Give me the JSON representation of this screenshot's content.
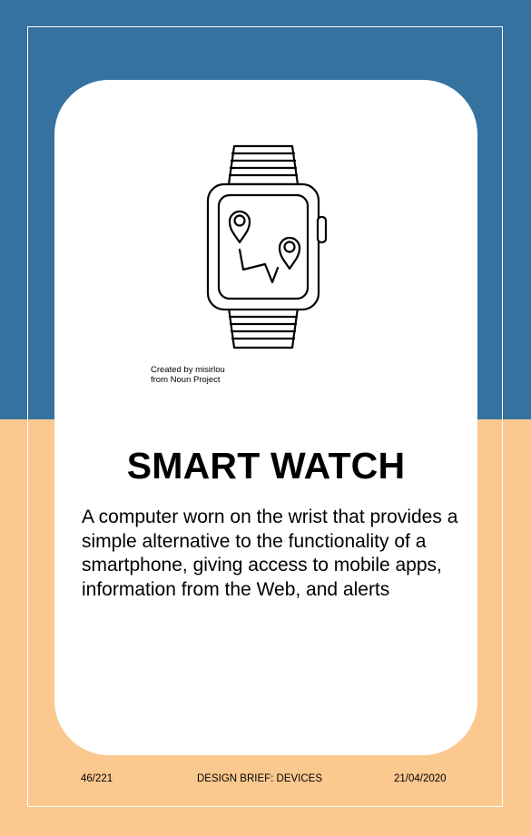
{
  "card": {
    "title": "SMART WATCH",
    "description": "A computer worn on the wrist that provides a simple alternative to the functionality of a smartphone, giving access to mobile apps, information from the Web, and alerts",
    "credit_line1": "Created by misirlou",
    "credit_line2": "from Noun Project",
    "icon": "smartwatch-map-icon"
  },
  "footer": {
    "page": "46/221",
    "section": "DESIGN BRIEF: DEVICES",
    "date": "21/04/2020"
  },
  "colors": {
    "top_background": "#3572a0",
    "bottom_background": "#fbc88f",
    "card": "#ffffff"
  }
}
